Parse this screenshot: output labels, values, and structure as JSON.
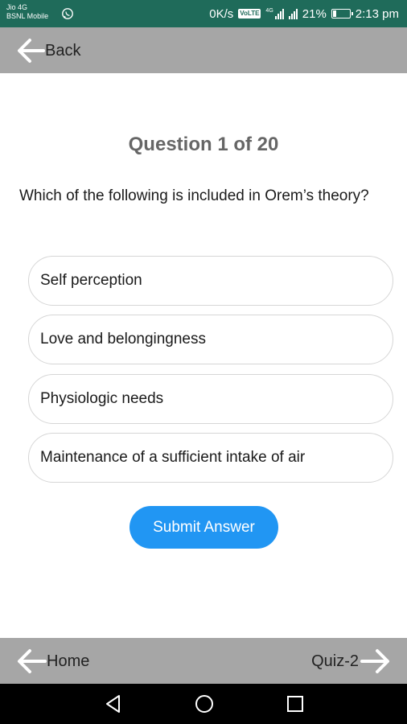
{
  "status_bar": {
    "carrier_1": "Jio 4G",
    "carrier_2": "BSNL Mobile",
    "speed": "0K/s",
    "volte": "VoLTE",
    "network_type": "4G",
    "battery_percent": "21%",
    "battery_level": 0.21,
    "time": "2:13 pm"
  },
  "header": {
    "back_label": "Back"
  },
  "quiz": {
    "question_title": "Question 1 of 20",
    "question_text": "Which of the following is included in Orem’s theory?",
    "options": [
      "Self perception",
      "Love and belongingness",
      "Physiologic needs",
      "Maintenance of a sufficient intake of air"
    ],
    "submit_label": "Submit Answer"
  },
  "footer": {
    "home_label": "Home",
    "next_label": "Quiz-2"
  },
  "colors": {
    "status_bar": "#1f6b5a",
    "header_bar": "#a6a6a6",
    "title_text": "#666666",
    "submit_button": "#2196f3",
    "option_border": "#d6d6d6",
    "nav_bar": "#000000"
  },
  "icons": {
    "status": [
      "whatsapp-icon",
      "signal-icon",
      "battery-icon"
    ],
    "header": "arrow-left-icon",
    "footer": [
      "arrow-left-icon",
      "arrow-right-icon"
    ],
    "navigation": [
      "nav-back-icon",
      "nav-home-icon",
      "nav-recents-icon"
    ]
  }
}
